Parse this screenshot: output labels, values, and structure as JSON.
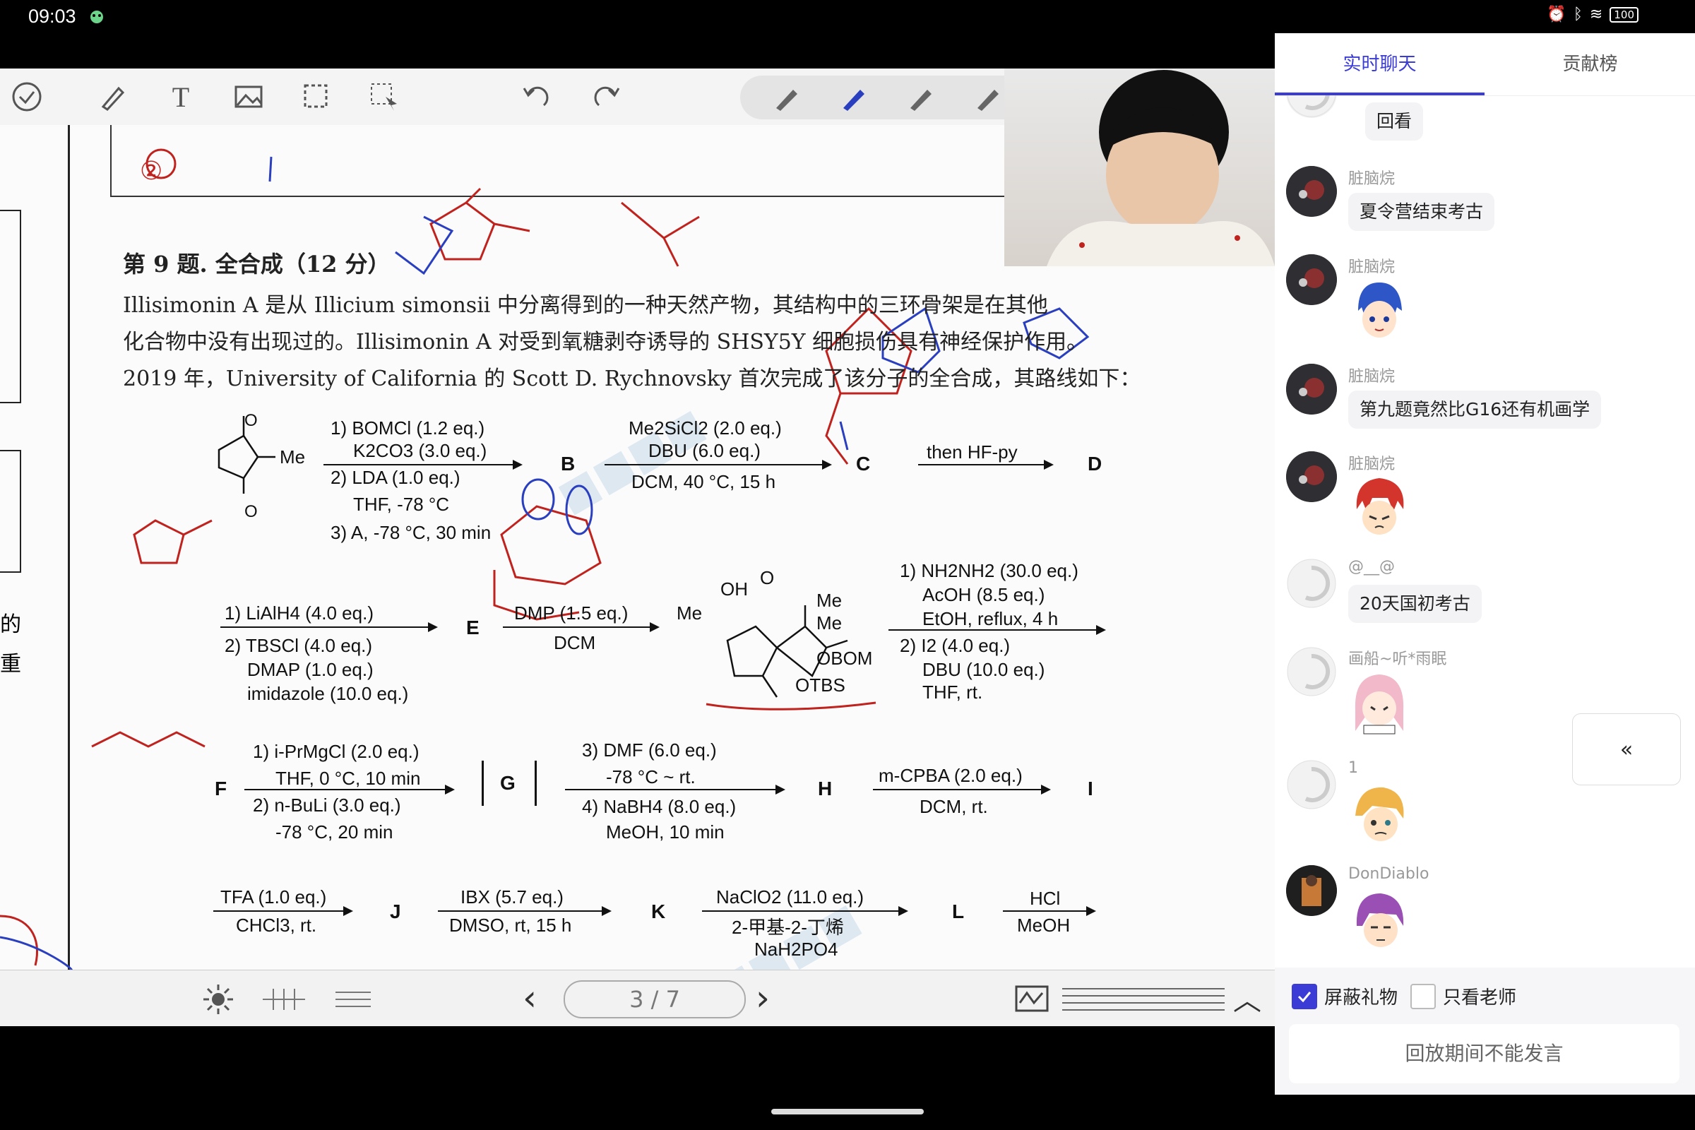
{
  "status": {
    "time": "09:03",
    "battery": "100"
  },
  "toolbar": {
    "tools": [
      "check-icon",
      "pen-icon",
      "text-icon",
      "image-icon",
      "lasso-icon",
      "select-icon",
      "undo-icon",
      "redo-icon"
    ],
    "pens": [
      "pen-gray",
      "pen-blue",
      "pen-gray-2",
      "pen-gray-3",
      "eraser"
    ]
  },
  "document": {
    "circled_number": "②",
    "question_title": "第 9 题. 全合成（12 分）",
    "paragraph": [
      "Illisimonin A 是从 Illicium simonsii 中分离得到的一种天然产物，其结构中的三环骨架是在其他",
      "化合物中没有出现过的。Illisimonin A 对受到氧糖剥夺诱导的 SHSY5Y 细胞损伤具有神经保护作用。",
      "2019 年，University of California 的 Scott D. Rychnovsky 首次完成了该分子的全合成，其路线如下："
    ],
    "row1": {
      "sm_label": "Me",
      "step1": [
        "1) BOMCl (1.2 eq.)",
        "K2CO3 (3.0 eq.)",
        "2) LDA (1.0 eq.)",
        "THF, -78 °C",
        "3) A, -78 °C, 30 min"
      ],
      "B": "B",
      "step2": [
        "Me2SiCl2 (2.0 eq.)",
        "DBU (6.0 eq.)",
        "DCM, 40 °C, 15 h"
      ],
      "C": "C",
      "step3": "then HF-py",
      "D": "D"
    },
    "row2": {
      "step1": [
        "1) LiAlH4 (4.0 eq.)",
        "2) TBSCl (4.0 eq.)",
        "DMAP (1.0 eq.)",
        "imidazole (10.0 eq.)"
      ],
      "E": "E",
      "step2": [
        "DMP (1.5 eq.)",
        "DCM"
      ],
      "product_labels": [
        "OH",
        "O",
        "Me",
        "Me",
        "Me",
        "OBOM",
        "OTBS"
      ],
      "step3": [
        "1) NH2NH2 (30.0 eq.)",
        "AcOH (8.5 eq.)",
        "EtOH, reflux, 4 h",
        "2) I2 (4.0 eq.)",
        "DBU (10.0 eq.)",
        "THF, rt."
      ]
    },
    "row3": {
      "F": "F",
      "step1": [
        "1) i-PrMgCl (2.0 eq.)",
        "THF, 0 °C, 10 min",
        "2) n-BuLi (3.0 eq.)",
        "-78 °C, 20 min"
      ],
      "G": "G",
      "step2": [
        "3) DMF (6.0 eq.)",
        "-78 °C ~ rt.",
        "4) NaBH4 (8.0 eq.)",
        "MeOH, 10 min"
      ],
      "H": "H",
      "step3": [
        "m-CPBA (2.0 eq.)",
        "DCM, rt."
      ],
      "I": "I"
    },
    "row4": {
      "step1": [
        "TFA (1.0 eq.)",
        "CHCl3, rt."
      ],
      "J": "J",
      "step2": [
        "IBX (5.7 eq.)",
        "DMSO, rt, 15 h"
      ],
      "K": "K",
      "step3": [
        "NaClO2 (11.0 eq.)",
        "2-甲基-2-丁烯",
        "NaH2PO4"
      ],
      "L": "L",
      "step4": [
        "HCl",
        "MeOH"
      ]
    },
    "left_margin_chars": [
      "的",
      "重"
    ]
  },
  "pager": {
    "current": "3",
    "total": "7",
    "label": "3 / 7"
  },
  "panel": {
    "tabs": [
      {
        "label": "实时聊天",
        "active": true
      },
      {
        "label": "贡献榜",
        "active": false
      }
    ],
    "messages": [
      {
        "user": "",
        "text": "回看",
        "avatar": "default"
      },
      {
        "user": "脏脑烷",
        "text": "夏令营结束考古",
        "avatar": "photo"
      },
      {
        "user": "脏脑烷",
        "text": "",
        "sticker": "blue-hair-sticker",
        "avatar": "photo"
      },
      {
        "user": "脏脑烷",
        "text": "第九题竟然比G16还有机画学",
        "avatar": "photo"
      },
      {
        "user": "脏脑烷",
        "text": "",
        "sticker": "red-hair-sticker",
        "avatar": "photo"
      },
      {
        "user": "@__@",
        "text": "20天国初考古",
        "avatar": "default"
      },
      {
        "user": "画船~听*雨眠",
        "text": "",
        "sticker": "pink-hair-sticker",
        "avatar": "default"
      },
      {
        "user": "1",
        "text": "",
        "sticker": "blonde-sticker",
        "avatar": "default"
      },
      {
        "user": "DonDiablo",
        "text": "",
        "sticker": "purple-hair-sticker",
        "avatar": "photo-dark"
      }
    ],
    "filters": [
      {
        "label": "屏蔽礼物",
        "checked": true
      },
      {
        "label": "只看老师",
        "checked": false
      }
    ],
    "input_placeholder": "回放期间不能发言",
    "collapse_icon": "«"
  }
}
